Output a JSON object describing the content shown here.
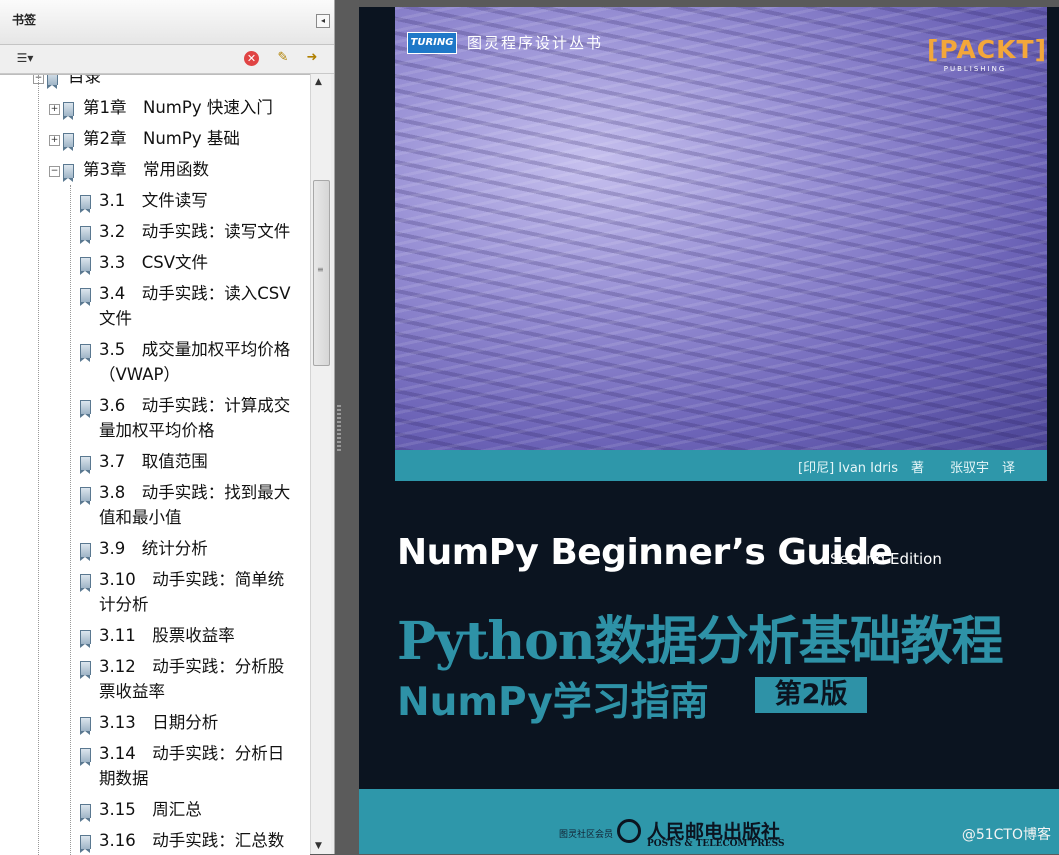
{
  "panel": {
    "title": "书签",
    "collapse_glyph": "◂",
    "toolbar": {
      "options_glyph": "☰▾",
      "delete_glyph": "✕",
      "new_glyph": "✎",
      "expand_glyph": "➜"
    }
  },
  "bookmarks": [
    {
      "label": "目录",
      "lines": [
        "目录"
      ],
      "level": 0,
      "toggle": "−"
    },
    {
      "label": "第1章　NumPy 快速入门",
      "lines": [
        "第1章　NumPy 快速入门"
      ],
      "level": 1,
      "toggle": "+"
    },
    {
      "label": "第2章　NumPy 基础",
      "lines": [
        "第2章　NumPy 基础"
      ],
      "level": 1,
      "toggle": "+"
    },
    {
      "label": "第3章　常用函数",
      "lines": [
        "第3章　常用函数"
      ],
      "level": 1,
      "toggle": "−"
    },
    {
      "label": "3.1　文件读写",
      "lines": [
        "3.1　文件读写"
      ],
      "level": 2
    },
    {
      "label": "3.2　动手实践：读写文件",
      "lines": [
        "3.2　动手实践：读写文件"
      ],
      "level": 2
    },
    {
      "label": "3.3　CSV文件",
      "lines": [
        "3.3　CSV文件"
      ],
      "level": 2
    },
    {
      "label": "3.4　动手实践：读入CSV文件",
      "lines": [
        "3.4　动手实践：读入CSV",
        "文件"
      ],
      "level": 2
    },
    {
      "label": "3.5　成交量加权平均价格（VWAP）",
      "lines": [
        "3.5　成交量加权平均价格",
        "（VWAP）"
      ],
      "level": 2
    },
    {
      "label": "3.6　动手实践：计算成交量加权平均价格",
      "lines": [
        "3.6　动手实践：计算成交",
        "量加权平均价格"
      ],
      "level": 2
    },
    {
      "label": "3.7　取值范围",
      "lines": [
        "3.7　取值范围"
      ],
      "level": 2
    },
    {
      "label": "3.8　动手实践：找到最大值和最小值",
      "lines": [
        "3.8　动手实践：找到最大",
        "值和最小值"
      ],
      "level": 2
    },
    {
      "label": "3.9　统计分析",
      "lines": [
        "3.9　统计分析"
      ],
      "level": 2
    },
    {
      "label": "3.10　动手实践：简单统计分析",
      "lines": [
        "3.10　动手实践：简单统",
        "计分析"
      ],
      "level": 2
    },
    {
      "label": "3.11　股票收益率",
      "lines": [
        "3.11　股票收益率"
      ],
      "level": 2
    },
    {
      "label": "3.12　动手实践：分析股票收益率",
      "lines": [
        "3.12　动手实践：分析股",
        "票收益率"
      ],
      "level": 2
    },
    {
      "label": "3.13　日期分析",
      "lines": [
        "3.13　日期分析"
      ],
      "level": 2
    },
    {
      "label": "3.14　动手实践：分析日期数据",
      "lines": [
        "3.14　动手实践：分析日",
        "期数据"
      ],
      "level": 2
    },
    {
      "label": "3.15　周汇总",
      "lines": [
        "3.15　周汇总"
      ],
      "level": 2
    },
    {
      "label": "3.16　动手实践：汇总数",
      "lines": [
        "3.16　动手实践：汇总数"
      ],
      "level": 2
    }
  ],
  "scrollbar": {
    "up_glyph": "▲",
    "down_glyph": "▼",
    "grip_glyph": "≡"
  },
  "cover": {
    "turing_logo": "TURING",
    "series_name": "图灵程序设计丛书",
    "packt_word": "[PACKT]",
    "packt_sub": "PUBLISHING",
    "authors": "[印尼] Ivan Idris　著　　张驭宇　译",
    "title_en": "NumPy Beginner’s Guide",
    "edition": "Second Edition",
    "title_cn": "Python数据分析基础教程",
    "subtitle_cn": "NumPy学习指南",
    "edition_badge": "第2版",
    "member_note": "图灵社区会员",
    "publisher": "人民邮电出版社",
    "publisher_en": "POSTS & TELECOM PRESS",
    "watermark": "@51CTO博客"
  }
}
